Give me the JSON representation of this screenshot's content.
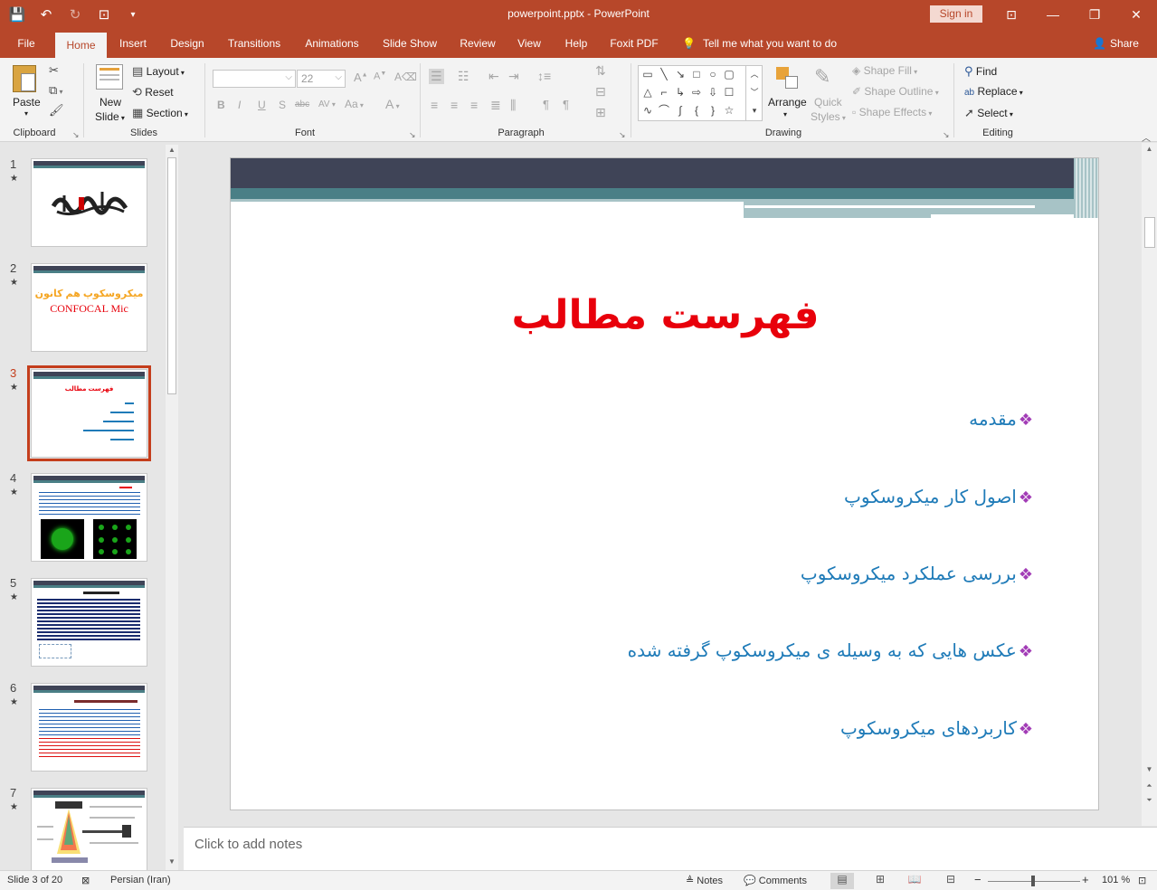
{
  "titlebar": {
    "doc_title": "powerpoint.pptx  -  PowerPoint",
    "signin": "Sign in",
    "qat": {
      "save": "💾",
      "undo": "↶",
      "redo": "↻",
      "present": "⊡",
      "customize": "▾"
    },
    "win": {
      "ribbon_options": "⊡",
      "minimize": "—",
      "restore": "❐",
      "close": "✕"
    }
  },
  "tabs": [
    "File",
    "Home",
    "Insert",
    "Design",
    "Transitions",
    "Animations",
    "Slide Show",
    "Review",
    "View",
    "Help",
    "Foxit PDF"
  ],
  "tellme": "Tell me what you want to do",
  "share": "Share",
  "ribbon": {
    "clipboard": {
      "label": "Clipboard",
      "paste": "Paste"
    },
    "slides": {
      "label": "Slides",
      "new_slide_1": "New",
      "new_slide_2": "Slide",
      "layout": "Layout",
      "reset": "Reset",
      "section": "Section"
    },
    "font": {
      "label": "Font",
      "font_name": "",
      "font_size": "22",
      "bold": "B",
      "italic": "I",
      "underline": "U",
      "shadow": "S",
      "strike": "abc",
      "spacing": "AV",
      "case": "Aa",
      "color": "A"
    },
    "paragraph": {
      "label": "Paragraph"
    },
    "drawing": {
      "label": "Drawing",
      "arrange": "Arrange",
      "quick_styles_1": "Quick",
      "quick_styles_2": "Styles",
      "shape_fill": "Shape Fill",
      "shape_outline": "Shape Outline",
      "shape_effects": "Shape Effects"
    },
    "editing": {
      "label": "Editing",
      "find": "Find",
      "replace": "Replace",
      "select": "Select"
    }
  },
  "thumbnails": [
    {
      "num": "1",
      "selected": false
    },
    {
      "num": "2",
      "selected": false,
      "title_fa": "میکروسکوپ هم کانون",
      "title_en": "CONFOCAL  Mic"
    },
    {
      "num": "3",
      "selected": true,
      "title_fa": "فهرست مطالب"
    },
    {
      "num": "4",
      "selected": false
    },
    {
      "num": "5",
      "selected": false
    },
    {
      "num": "6",
      "selected": false
    },
    {
      "num": "7",
      "selected": false
    }
  ],
  "slide": {
    "title": "فهرست مطالب",
    "bullets": [
      "مقدمه",
      "اصول کار میکروسکوپ",
      "بررسی عملکرد میکروسکوپ",
      "عکس هایی که به وسیله ی میکروسکوپ گرفته شده",
      "کاربردهای میکروسکوپ"
    ],
    "colors": {
      "title": "#e8000b",
      "bullet_text": "#1f7bb8",
      "bullet_marker": "#a23cb6",
      "band_dark": "#3f4457",
      "band_teal": "#4a7f86"
    }
  },
  "notes": {
    "placeholder": "Click to add notes"
  },
  "status": {
    "slide_info": "Slide 3 of 20",
    "language": "Persian (Iran)",
    "notes": "Notes",
    "comments": "Comments",
    "zoom": "101 %"
  }
}
